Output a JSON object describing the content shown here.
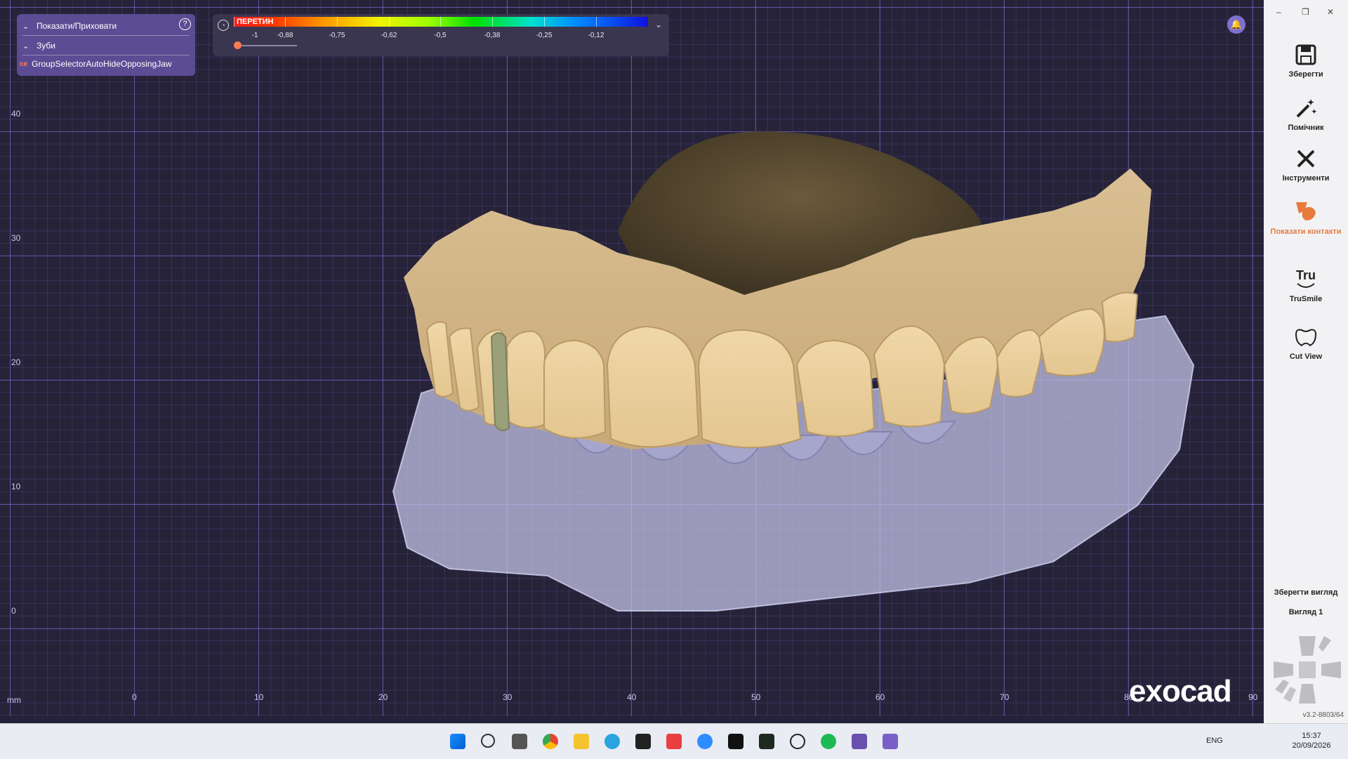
{
  "panel": {
    "show_hide": "Показати/Приховати",
    "teeth": "Зуби",
    "overlay_text": "GroupSelectorAutoHideOpposingJaw",
    "help": "?"
  },
  "scale": {
    "label": "ПЕРЕТИН",
    "ticks": [
      "-1",
      "-0,88",
      "-0,75",
      "-0,62",
      "-0,5",
      "-0,38",
      "-0,25",
      "-0,12"
    ]
  },
  "axes": {
    "unit": "mm",
    "y_ticks": [
      "40",
      "30",
      "20",
      "10",
      "0"
    ],
    "x_ticks": [
      "0",
      "10",
      "20",
      "30",
      "40",
      "50",
      "60",
      "70",
      "80",
      "90"
    ]
  },
  "sidebar": {
    "items": [
      {
        "label": "Зберегти",
        "icon": "save-icon"
      },
      {
        "label": "Помічник",
        "icon": "wizard-icon"
      },
      {
        "label": "Інструменти",
        "icon": "tools-icon"
      },
      {
        "label": "Показати контакти",
        "icon": "contacts-icon"
      },
      {
        "label": "TruSmile",
        "icon": "trusmile-icon"
      },
      {
        "label": "Cut View",
        "icon": "cut-view-icon"
      }
    ],
    "save_view": "Зберегти вигляд",
    "view1": "Вигляд 1",
    "version": "v3.2-8803/64",
    "brand": "exocad"
  },
  "taskbar": {
    "lang": "ENG",
    "time": "15:37",
    "date": "20/09/2026"
  },
  "colors": {
    "accent": "#e87a3e",
    "panel": "#5b4c93",
    "grid": "#8c6ee6"
  }
}
